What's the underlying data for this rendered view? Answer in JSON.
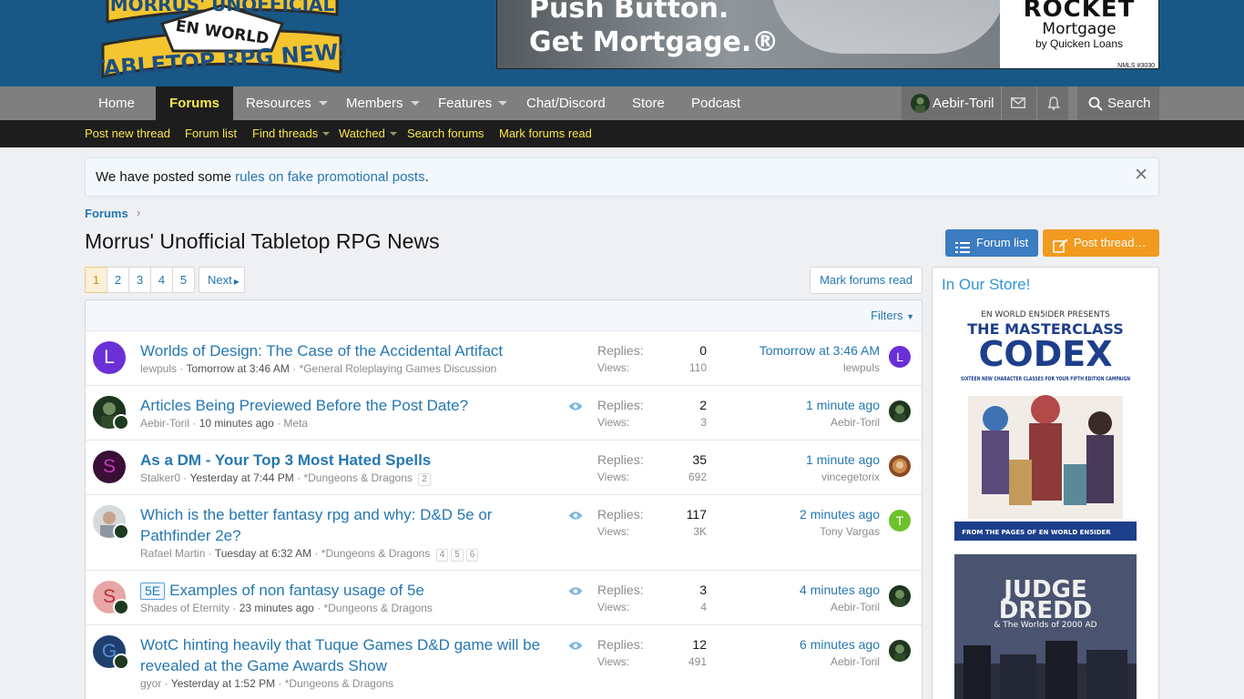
{
  "header": {
    "logo_top": "MORRUS' UNOFFICIAL",
    "logo_badge": "EN WORLD",
    "logo_bottom": "TABLETOP RPG NEWS"
  },
  "banner": {
    "line1": "Push Button.",
    "line2": "Get Mortgage.®",
    "brand1": "ROCKET",
    "brand2": "Mortgage",
    "brand3": "by Quicken Loans",
    "brand4": "NMLS #3030"
  },
  "nav": {
    "tabs": [
      {
        "label": "Home"
      },
      {
        "label": "Forums"
      },
      {
        "label": "Resources"
      },
      {
        "label": "Members"
      },
      {
        "label": "Features"
      },
      {
        "label": "Chat/Discord"
      },
      {
        "label": "Store"
      },
      {
        "label": "Podcast"
      }
    ],
    "user": "Aebir-Toril",
    "search": "Search"
  },
  "subnav": {
    "items": [
      {
        "label": "Post new thread"
      },
      {
        "label": "Forum list"
      },
      {
        "label": "Find threads"
      },
      {
        "label": "Watched"
      },
      {
        "label": "Search forums"
      },
      {
        "label": "Mark forums read"
      }
    ]
  },
  "notice": {
    "text_before": "We have posted some ",
    "link": "rules on fake promotional posts",
    "text_after": "."
  },
  "breadcrumb": "Forums",
  "page_title": "Morrus' Unofficial Tabletop RPG News",
  "buttons": {
    "forum_list": "Forum list",
    "post_thread": "Post thread…"
  },
  "pagination": {
    "pages": [
      "1",
      "2",
      "3",
      "4",
      "5"
    ],
    "current": "1",
    "next": "Next"
  },
  "mark_read": "Mark forums read",
  "filters": "Filters",
  "labels": {
    "replies": "Replies:",
    "views": "Views:"
  },
  "threads": [
    {
      "title": "Worlds of Design: The Case of the Accidental Artifact",
      "author": "lewpuls",
      "date": "Tomorrow at 3:46 AM",
      "forum": "*General Roleplaying Games Discussion",
      "replies": "0",
      "views": "110",
      "last_time": "Tomorrow at 3:46 AM",
      "last_user": "lewpuls",
      "avatar_letter": "L",
      "avatar_color": "#6b2fd6",
      "last_avatar_letter": "L",
      "last_avatar_color": "#6b2fd6"
    },
    {
      "title": "Articles Being Previewed Before the Post Date?",
      "author": "Aebir-Toril",
      "date": "10 minutes ago",
      "forum": "Meta",
      "replies": "2",
      "views": "3",
      "last_time": "1 minute ago",
      "last_user": "Aebir-Toril"
    },
    {
      "title": "As a DM - Your Top 3 Most Hated Spells",
      "author": "Stalker0",
      "date": "Yesterday at 7:44 PM",
      "forum": "*Dungeons & Dragons",
      "pages": [
        "2"
      ],
      "replies": "35",
      "views": "692",
      "last_time": "1 minute ago",
      "last_user": "vincegetorix",
      "avatar_letter": "S",
      "avatar_color": "#3a0e36"
    },
    {
      "title": "Which is the better fantasy rpg and why: D&D 5e or Pathfinder 2e?",
      "author": "Rafael Martin",
      "date": "Tuesday at 6:32 AM",
      "forum": "*Dungeons & Dragons",
      "pages": [
        "4",
        "5",
        "6"
      ],
      "replies": "117",
      "views": "3K",
      "last_time": "2 minutes ago",
      "last_user": "Tony Vargas",
      "last_avatar_letter": "T",
      "last_avatar_color": "#6dc22d"
    },
    {
      "prefix": "5E",
      "title": "Examples of non fantasy usage of 5e",
      "author": "Shades of Eternity",
      "date": "23 minutes ago",
      "forum": "*Dungeons & Dragons",
      "replies": "3",
      "views": "4",
      "last_time": "4 minutes ago",
      "last_user": "Aebir-Toril",
      "avatar_letter": "S",
      "avatar_color": "#e9a6a6"
    },
    {
      "title": "WotC hinting heavily that Tuque Games D&D game will be revealed at the Game Awards Show",
      "author": "gyor",
      "date": "Yesterday at 1:52 PM",
      "forum": "*Dungeons & Dragons",
      "replies": "12",
      "views": "491",
      "last_time": "6 minutes ago",
      "last_user": "Aebir-Toril",
      "avatar_letter": "G",
      "avatar_color": "#1f3f6e"
    }
  ],
  "sidebar": {
    "title": "In Our Store!",
    "ad1": {
      "top": "EN WORLD EN5IDER PRESENTS",
      "title1": "THE MASTERCLASS",
      "title2": "CODEX",
      "subtitle": "SIXTEEN NEW CHARACTER CLASSES FOR YOUR FIFTH EDITION CAMPAIGN",
      "footer": "FROM THE PAGES OF EN WORLD EN5IDER"
    },
    "ad2": {
      "title1": "JUDGE",
      "title2": "DREDD",
      "subtitle": "& The Worlds of 2000 AD"
    }
  }
}
